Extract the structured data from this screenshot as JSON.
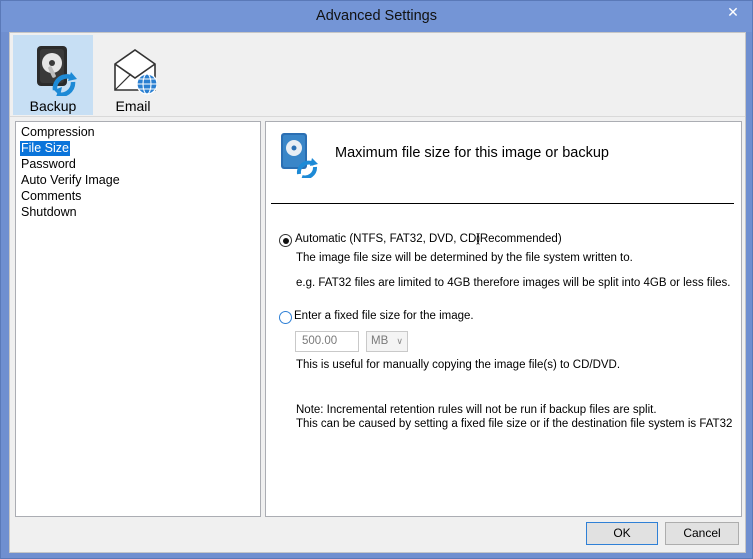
{
  "window": {
    "title": "Advanced Settings",
    "close_glyph": "✕"
  },
  "ribbon": {
    "tabs": [
      {
        "label": "Backup",
        "icon": "backup-drive-icon",
        "selected": true
      },
      {
        "label": "Email",
        "icon": "email-globe-icon",
        "selected": false
      }
    ]
  },
  "categories": {
    "items": [
      "Compression",
      "File Size",
      "Password",
      "Auto Verify Image",
      "Comments",
      "Shutdown"
    ],
    "selected": "File Size"
  },
  "panel": {
    "heading": "Maximum file size for this image or backup",
    "heading_icon": "backup-drive-icon",
    "auto_option": {
      "label": "Automatic (NTFS, FAT32, DVD, CD)",
      "tag": "(Recommended)",
      "checked": true,
      "desc1": "The image file size will be determined by the file system written to.",
      "desc2": "e.g. FAT32 files are limited to 4GB therefore images will be split into 4GB or less files."
    },
    "fixed_option": {
      "label": "Enter a fixed file size for the image.",
      "checked": false,
      "size_value": "500.00",
      "unit": "MB",
      "desc": "This is useful for manually copying the image file(s) to CD/DVD."
    },
    "note1": "Note: Incremental retention rules will not be run if backup files are split.",
    "note2": "This can be caused by setting a fixed file size or if the destination file system is FAT32"
  },
  "buttons": {
    "ok": "OK",
    "cancel": "Cancel"
  },
  "colors": {
    "titlebar": "#7495d6",
    "selection": "#0a74da",
    "ribbon_selected": "#c7dff4",
    "accent": "#2f80d6"
  }
}
